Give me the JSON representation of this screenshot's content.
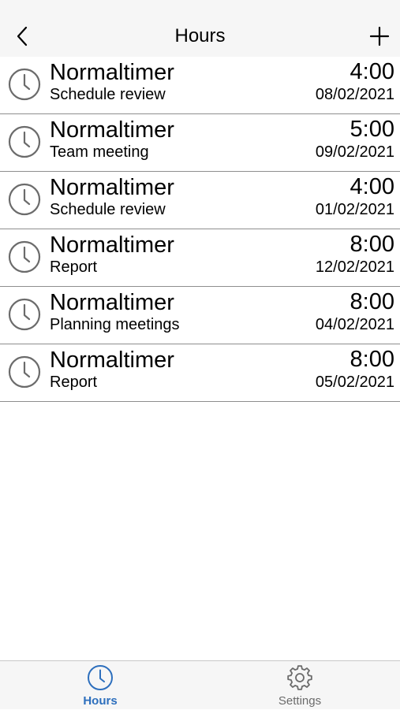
{
  "navbar": {
    "title": "Hours",
    "back_icon": "chevron-left-icon",
    "add_icon": "plus-icon"
  },
  "entries": [
    {
      "title": "Normaltimer",
      "subtitle": "Schedule review",
      "time": "4:00",
      "date": "08/02/2021"
    },
    {
      "title": "Normaltimer",
      "subtitle": "Team meeting",
      "time": "5:00",
      "date": "09/02/2021"
    },
    {
      "title": "Normaltimer",
      "subtitle": "Schedule review",
      "time": "4:00",
      "date": "01/02/2021"
    },
    {
      "title": "Normaltimer",
      "subtitle": "Report",
      "time": "8:00",
      "date": "12/02/2021"
    },
    {
      "title": "Normaltimer",
      "subtitle": "Planning meetings",
      "time": "8:00",
      "date": "04/02/2021"
    },
    {
      "title": "Normaltimer",
      "subtitle": "Report",
      "time": "8:00",
      "date": "05/02/2021"
    }
  ],
  "tabbar": {
    "hours_label": "Hours",
    "settings_label": "Settings",
    "active_tab": "Hours",
    "active_color": "#2d6fbd",
    "inactive_color": "#6b6b6b"
  },
  "colors": {
    "bar_background": "#f6f6f6",
    "row_divider": "#8e8e8e",
    "icon_gray": "#6b6b6b"
  }
}
